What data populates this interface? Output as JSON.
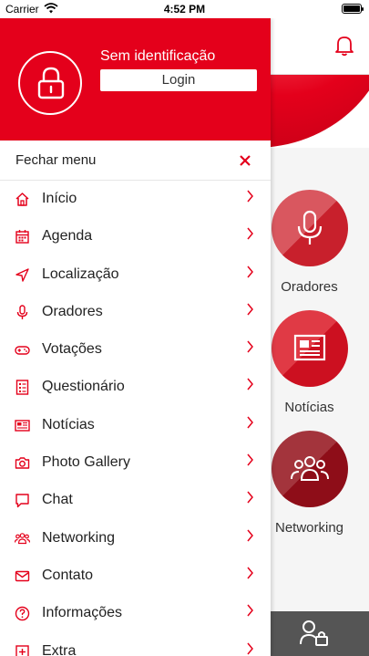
{
  "status_bar": {
    "carrier": "Carrier",
    "time": "4:52 PM"
  },
  "drawer": {
    "user_status": "Sem identificação",
    "login_label": "Login",
    "close_label": "Fechar menu",
    "items": [
      {
        "label": "Início",
        "icon": "home-icon"
      },
      {
        "label": "Agenda",
        "icon": "calendar-icon"
      },
      {
        "label": "Localização",
        "icon": "location-arrow-icon"
      },
      {
        "label": "Oradores",
        "icon": "microphone-icon"
      },
      {
        "label": "Votações",
        "icon": "gamepad-icon"
      },
      {
        "label": "Questionário",
        "icon": "checklist-icon"
      },
      {
        "label": "Notícias",
        "icon": "newspaper-icon"
      },
      {
        "label": "Photo Gallery",
        "icon": "camera-icon"
      },
      {
        "label": "Chat",
        "icon": "chat-bubble-icon"
      },
      {
        "label": "Networking",
        "icon": "people-icon"
      },
      {
        "label": "Contato",
        "icon": "envelope-icon"
      },
      {
        "label": "Informações",
        "icon": "question-circle-icon"
      },
      {
        "label": "Extra",
        "icon": "plus-square-icon"
      }
    ]
  },
  "background": {
    "tiles": [
      {
        "label": "Oradores",
        "icon": "microphone-icon"
      },
      {
        "label": "Notícias",
        "icon": "newspaper-icon"
      },
      {
        "label": "Networking",
        "icon": "people-icon"
      }
    ]
  },
  "colors": {
    "accent": "#e4001b",
    "tabbar": "#555555"
  }
}
